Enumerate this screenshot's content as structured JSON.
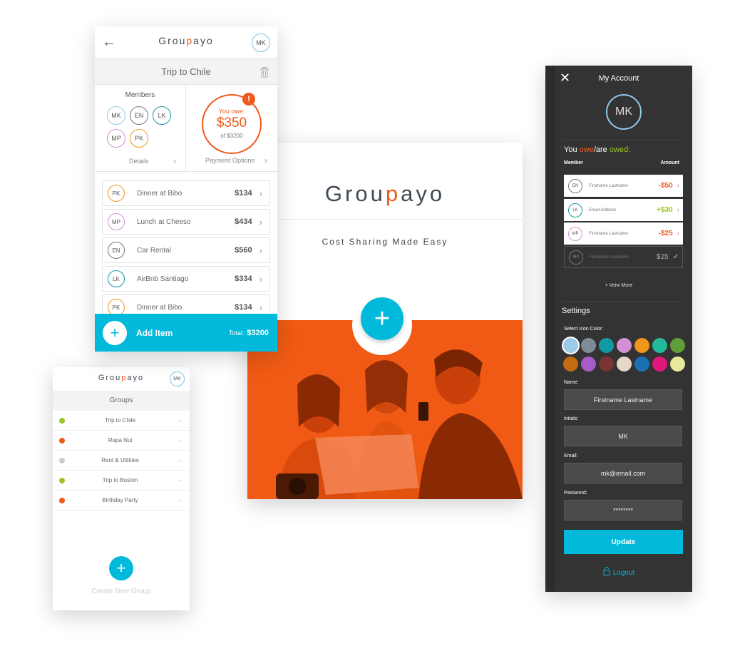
{
  "brand": {
    "logo_pre": "Grou",
    "logo_q": "p",
    "logo_post": "ayo",
    "accent": "#00b9db",
    "orange": "#f05a1a"
  },
  "trip": {
    "back_icon": "arrow-left-icon",
    "user_initials": "MK",
    "title": "Trip to Chile",
    "members_title": "Members",
    "members": [
      {
        "initials": "MK",
        "color": "#8ecbe8"
      },
      {
        "initials": "EN",
        "color": "#6b7b86"
      },
      {
        "initials": "LK",
        "color": "#119aa6"
      },
      {
        "initials": "MP",
        "color": "#d58fd6"
      },
      {
        "initials": "PK",
        "color": "#f2951c"
      }
    ],
    "details_label": "Details",
    "owe_label": "You owe:",
    "owe_amount": "$350",
    "owe_of": "of $3200",
    "alert": "!",
    "payment_label": "Payment Options",
    "items": [
      {
        "initials": "PK",
        "color": "#f2951c",
        "name": "Dinner at Bibo",
        "amount": "$134"
      },
      {
        "initials": "MP",
        "color": "#d58fd6",
        "name": "Lunch at Cheeso",
        "amount": "$434"
      },
      {
        "initials": "EN",
        "color": "#6b7b86",
        "name": "Car Rental",
        "amount": "$560"
      },
      {
        "initials": "LK",
        "color": "#119aa6",
        "name": "AirBnb Santiago",
        "amount": "$334"
      },
      {
        "initials": "PK",
        "color": "#f2951c",
        "name": "Dinner at Bibo",
        "amount": "$134"
      }
    ],
    "add_label": "Add Item",
    "total_label": "Total:",
    "total_value": "$3200"
  },
  "groups": {
    "user_initials": "MK",
    "title": "Groups",
    "items": [
      {
        "name": "Trip to Chile",
        "color": "#9bc523"
      },
      {
        "name": "Rapa Nui",
        "color": "#f05a1a"
      },
      {
        "name": "Rent & Utilities",
        "color": "#cccccc"
      },
      {
        "name": "Trip to Boston",
        "color": "#9bc523"
      },
      {
        "name": "Birthday Party",
        "color": "#f05a1a"
      }
    ],
    "create_label": "Create New Group"
  },
  "splash": {
    "tagline": "Cost Sharing Made Easy"
  },
  "account": {
    "title": "My Account",
    "initials": "MK",
    "owe_you": "You ",
    "owe_word": "owe",
    "owe_sep": "/are ",
    "owed_word": "owed:",
    "col_member": "Member",
    "col_amount": "Amount",
    "members": [
      {
        "initials": "EN",
        "color": "#6b7b86",
        "name": "Firstname Lastname",
        "amount": "-$50",
        "amount_color": "#f05a1a",
        "settled": false
      },
      {
        "initials": "LK",
        "color": "#119aa6",
        "name": "Email Address",
        "amount": "+$30",
        "amount_color": "#9bc523",
        "settled": false
      },
      {
        "initials": "MP",
        "color": "#d58fd6",
        "name": "Firstname Lastname",
        "amount": "-$25",
        "amount_color": "#f05a1a",
        "settled": false
      },
      {
        "initials": "MP",
        "color": "#777777",
        "name": "Firstname Lastname",
        "amount": "$25",
        "amount_color": "#aaaaaa",
        "settled": true
      }
    ],
    "view_more": "+ Veiw More",
    "settings_title": "Settings",
    "color_label": "Select Icon Color:",
    "swatches": [
      "#9ccbe8",
      "#7d8b96",
      "#119aa6",
      "#d58fd6",
      "#f2951c",
      "#22b89a",
      "#5f9e3a",
      "#c46a12",
      "#a85cc9",
      "#7a3434",
      "#e6d8c8",
      "#1a6fb5",
      "#e0177a",
      "#e8e89a"
    ],
    "name_label": "Name:",
    "name_value": "Firstname Lastname",
    "initials_label": "Initals:",
    "initials_value": "MK",
    "email_label": "Email:",
    "email_value": "mk@email.com",
    "password_label": "Password:",
    "password_value": "********",
    "update_label": "Update",
    "logout_label": "Logout"
  }
}
